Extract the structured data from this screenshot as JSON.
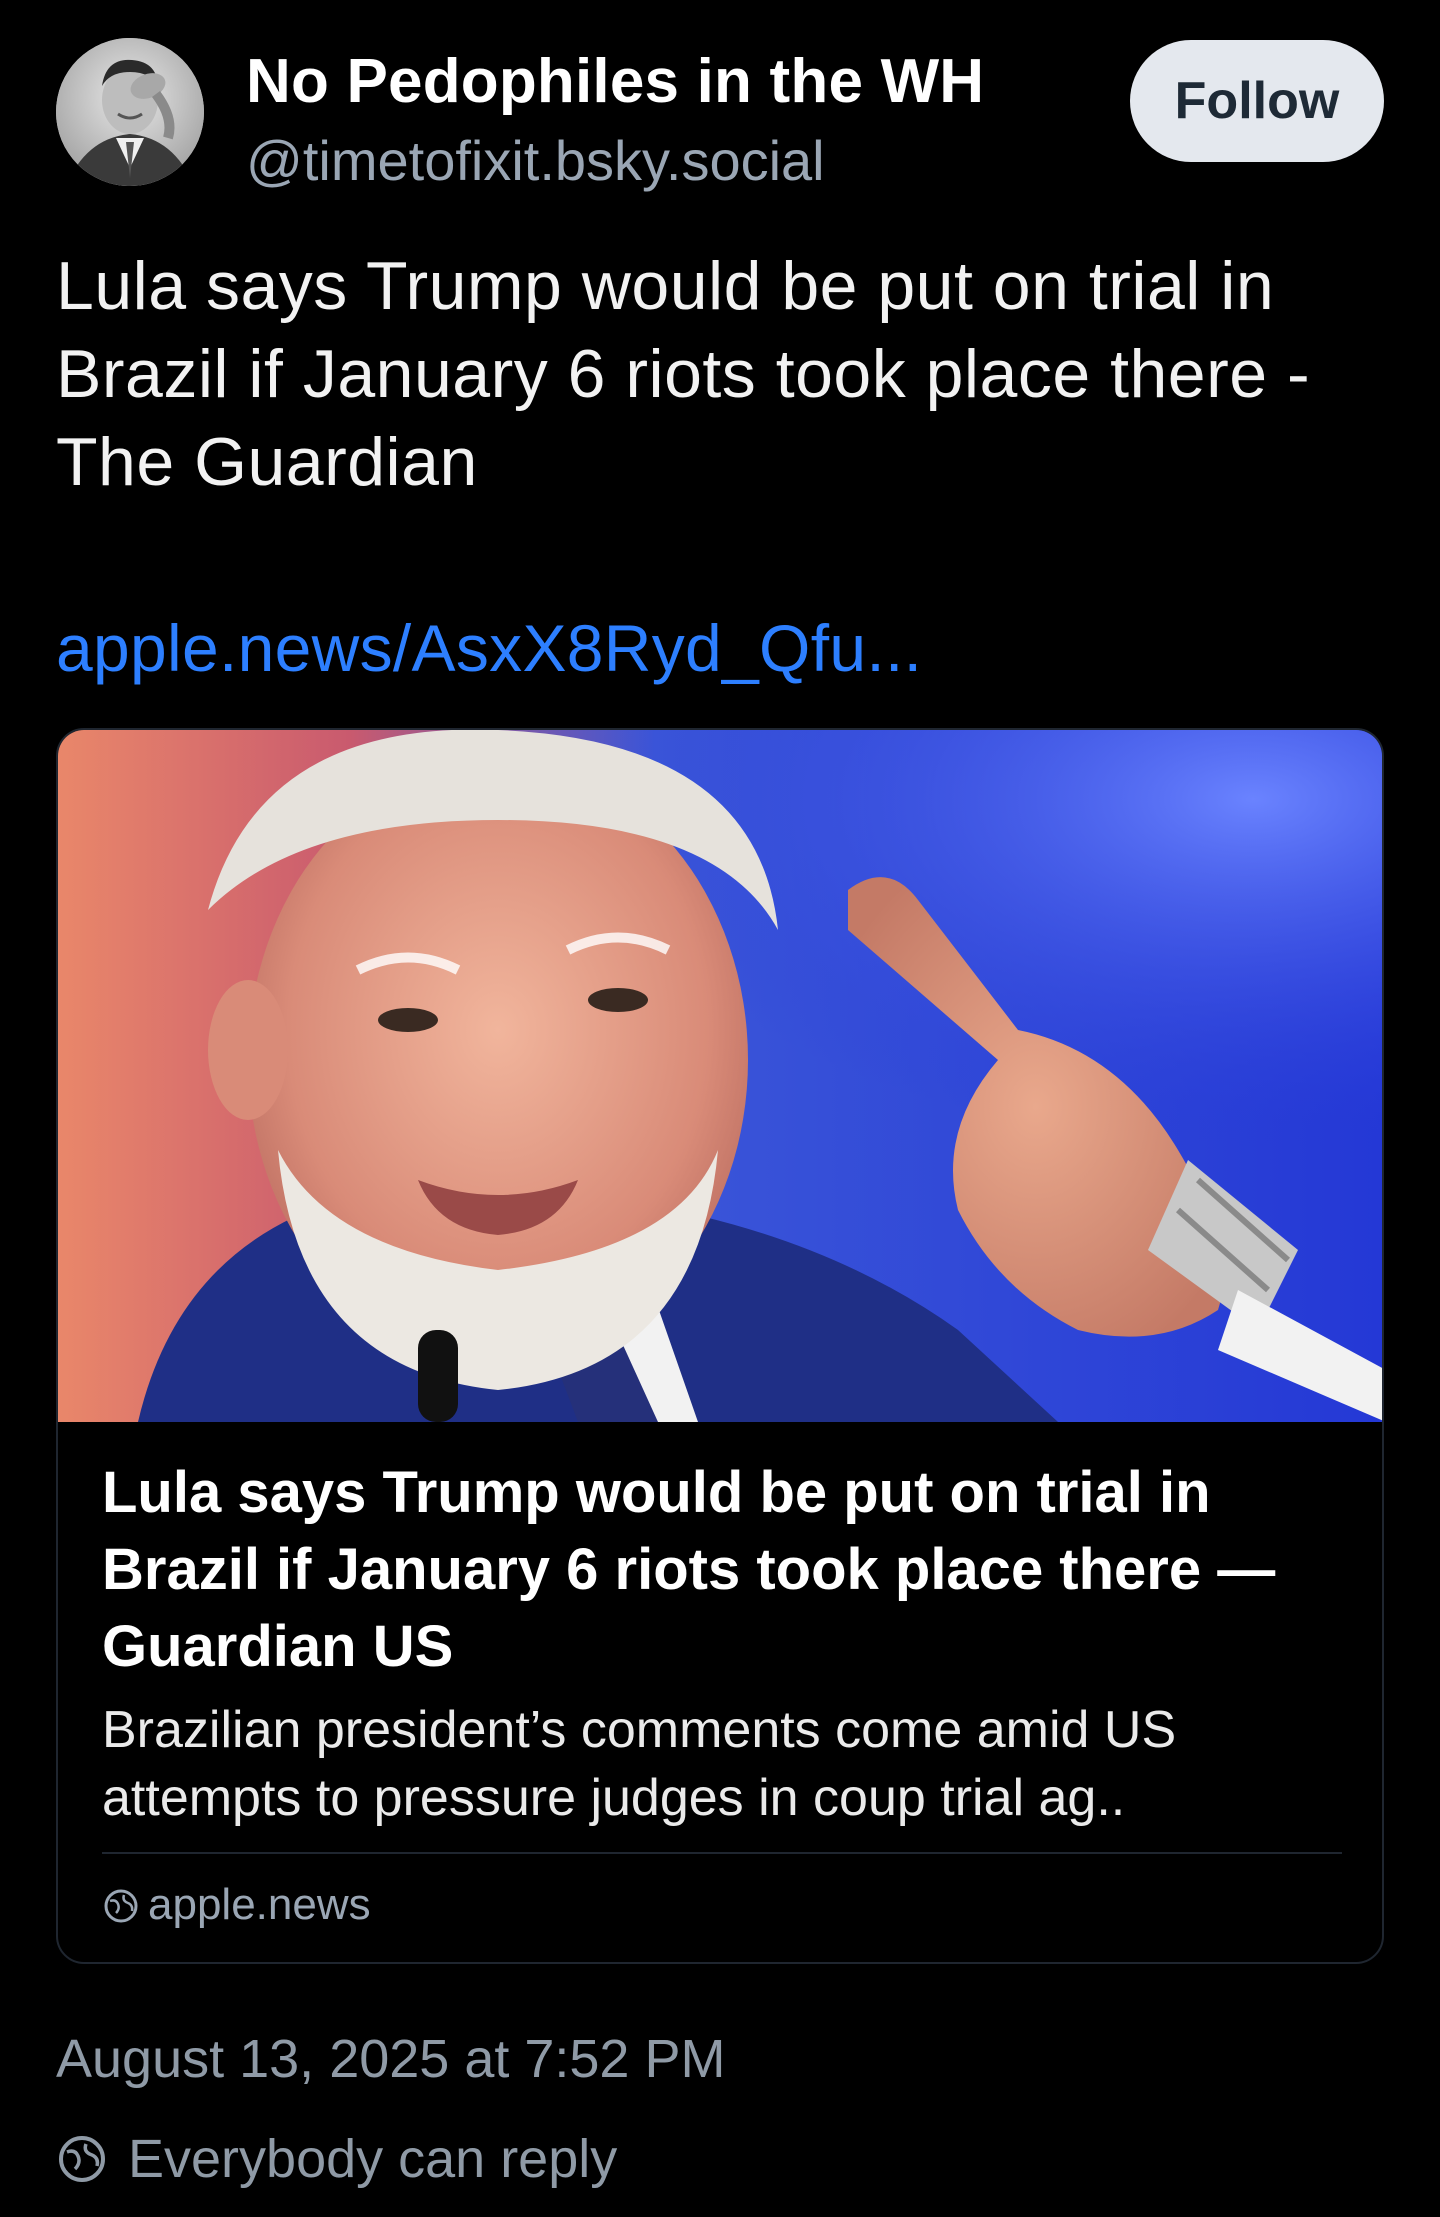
{
  "post": {
    "author": {
      "display_name": "No Pedophiles in the WH",
      "handle": "@timetofixit.bsky.social",
      "avatar_icon": "avatar-photo"
    },
    "follow_label": "Follow",
    "text": "Lula says Trump would be put on trial in Brazil if January 6 riots took place there - The Guardian",
    "link_text": "apple.news/AsxX8Ryd_Qfu...",
    "card": {
      "image_icon": "news-photo",
      "title": "Lula says Trump would be put on trial in Brazil if January 6 riots took place there — Guardian US",
      "description": "Brazilian president’s comments come amid US attempts to pressure judges in coup trial ag..",
      "domain": "apple.news",
      "domain_icon": "globe-icon"
    },
    "timestamp": "August 13, 2025 at 7:52 PM",
    "reply_setting": "Everybody can reply",
    "reply_icon": "globe-icon"
  },
  "colors": {
    "background": "#000000",
    "link": "#2d7fff",
    "muted": "#8f9aa6",
    "follow_bg": "#e4e8ee",
    "card_border": "#1f2630"
  }
}
